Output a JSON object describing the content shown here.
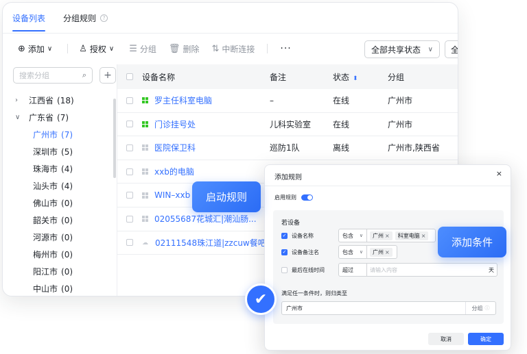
{
  "tabs": [
    {
      "label": "设备列表",
      "active": true
    },
    {
      "label": "分组规则",
      "active": false
    }
  ],
  "toolbar": {
    "add": "添加",
    "authorize": "授权",
    "group": "分组",
    "delete": "删除",
    "disconnect": "中断连接",
    "more": "···",
    "share_filter": "全部共享状态",
    "all_filter": "全"
  },
  "sidebar": {
    "search_placeholder": "搜索分组",
    "add_symbol": "+",
    "tree": [
      {
        "label": "江西省",
        "count": "(18)",
        "expanded": false,
        "level": 0
      },
      {
        "label": "广东省",
        "count": "(7)",
        "expanded": true,
        "level": 0
      },
      {
        "label": "广州市",
        "count": "(7)",
        "level": 1,
        "selected": true
      },
      {
        "label": "深圳市",
        "count": "(5)",
        "level": 1
      },
      {
        "label": "珠海市",
        "count": "(4)",
        "level": 1
      },
      {
        "label": "汕头市",
        "count": "(4)",
        "level": 1
      },
      {
        "label": "佛山市",
        "count": "(0)",
        "level": 1
      },
      {
        "label": "韶关市",
        "count": "(0)",
        "level": 1
      },
      {
        "label": "河源市",
        "count": "(0)",
        "level": 1
      },
      {
        "label": "梅州市",
        "count": "(0)",
        "level": 1
      },
      {
        "label": "阳江市",
        "count": "(0)",
        "level": 1
      },
      {
        "label": "中山市",
        "count": "(0)",
        "level": 1
      }
    ]
  },
  "table": {
    "headers": {
      "name": "设备名称",
      "note": "备注",
      "status": "状态",
      "group": "分组"
    },
    "rows": [
      {
        "name": "罗主任科室电脑",
        "note": "–",
        "status": "在线",
        "group": "广州市",
        "icon": "windows-on"
      },
      {
        "name": "门诊挂号处",
        "note": "儿科实验室",
        "status": "在线",
        "group": "广州市",
        "icon": "windows-on"
      },
      {
        "name": "医院保卫科",
        "note": "巡防1队",
        "status": "离线",
        "group": "广州市,陕西省",
        "icon": "windows-off"
      },
      {
        "name": "xxb的电脑",
        "note": "",
        "status": "",
        "group": "",
        "icon": "windows-off"
      },
      {
        "name": "WIN–xxb",
        "note": "",
        "status": "",
        "group": "",
        "icon": "windows-off"
      },
      {
        "name": "02055687花城汇|潮汕肠...",
        "note": "",
        "status": "",
        "group": "",
        "icon": "windows-off"
      },
      {
        "name": "02111548珠江道|zzcuw餐吧",
        "note": "",
        "status": "",
        "group": "",
        "icon": "cloud"
      }
    ]
  },
  "callouts": {
    "rule": "启动规则",
    "condition": "添加条件"
  },
  "dialog": {
    "title": "添加规则",
    "close": "×",
    "enable_label": "启用规则",
    "enabled": true,
    "if_label": "若设备",
    "conditions": [
      {
        "label": "设备名称",
        "checked": true,
        "operator": "包含",
        "chips": [
          "广州",
          "科室电脑"
        ],
        "placeholder": "",
        "unit": ""
      },
      {
        "label": "设备备注名",
        "checked": true,
        "operator": "包含",
        "chips": [
          "广州"
        ],
        "placeholder": "",
        "unit": ""
      },
      {
        "label": "最后在线时间",
        "checked": false,
        "operator": "超过",
        "chips": [],
        "placeholder": "请输入内容",
        "unit": "天"
      }
    ],
    "any_label": "满足任一条件时，则归类至",
    "group_value": "广州市",
    "group_suffix": "分组",
    "cancel": "取消",
    "ok": "确定"
  },
  "colors": {
    "accent": "#3370ff",
    "online_icon": "#34c724"
  }
}
